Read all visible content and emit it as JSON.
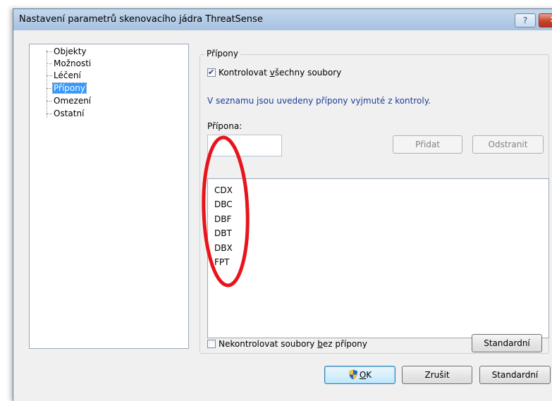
{
  "window": {
    "title": "Nastavení parametrů skenovacího jádra ThreatSense",
    "help_label": "?",
    "close_label": "✕"
  },
  "tree": {
    "items": [
      {
        "label": "Objekty"
      },
      {
        "label": "Možnosti"
      },
      {
        "label": "Léčení"
      },
      {
        "label": "Přípony",
        "selected": true
      },
      {
        "label": "Omezení"
      },
      {
        "label": "Ostatní"
      }
    ]
  },
  "group": {
    "legend": "Přípony",
    "check_all": {
      "pre": "Kontrolovat ",
      "accel": "v",
      "post": "šechny soubory",
      "checked": true
    },
    "info": "V seznamu jsou uvedeny přípony vyjmuté z kontroly.",
    "extension_label": "Přípona:",
    "extension_value": "",
    "add_button": "Přidat",
    "remove_button": "Odstranit",
    "extensions": [
      "CDX",
      "DBC",
      "DBF",
      "DBT",
      "DBX",
      "FPT"
    ],
    "no_ext": {
      "pre": "Nekontrolovat soubory ",
      "accel": "b",
      "post": "ez přípony",
      "checked": false
    },
    "default_button": "Standardní"
  },
  "footer": {
    "ok_accel": "O",
    "ok_rest": "K",
    "cancel_button": "Zrušit",
    "default_button": "Standardní"
  },
  "colors": {
    "annotation": "#e8141b",
    "selection": "#3399ff",
    "info_text": "#1d3c9a"
  }
}
